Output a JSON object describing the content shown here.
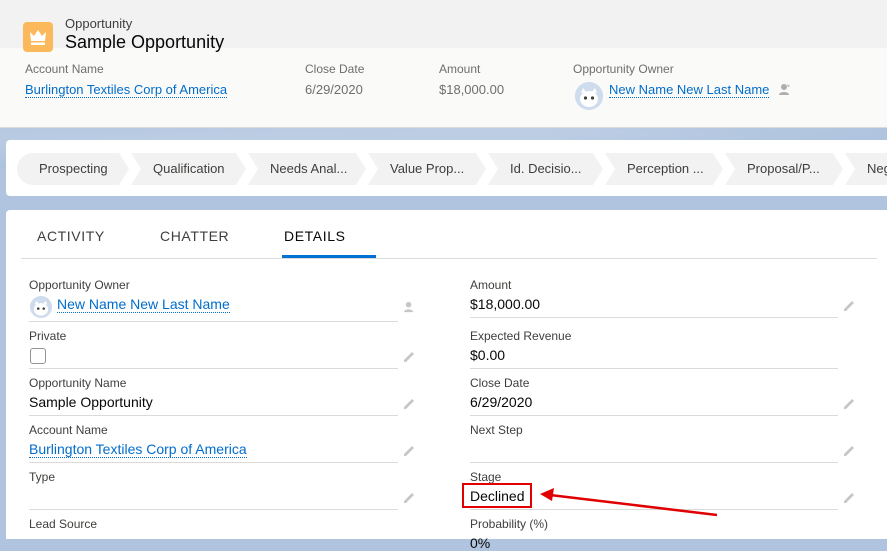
{
  "header": {
    "object_type": "Opportunity",
    "record_title": "Sample Opportunity",
    "icon": "crown-icon",
    "icon_color": "#fcb95b",
    "fields": [
      {
        "label": "Account Name",
        "value": "Burlington Textiles Corp of America"
      },
      {
        "label": "Close Date",
        "value": "6/29/2020"
      },
      {
        "label": "Amount",
        "value": "$18,000.00"
      },
      {
        "label": "Opportunity Owner",
        "value": "New Name New Last Name"
      }
    ]
  },
  "path": {
    "steps": [
      "Prospecting",
      "Qualification",
      "Needs Anal...",
      "Value Prop...",
      "Id. Decisio...",
      "Perception ...",
      "Proposal/P...",
      "Nego"
    ]
  },
  "tabs": [
    {
      "label": "ACTIVITY"
    },
    {
      "label": "CHATTER"
    },
    {
      "label": "DETAILS"
    }
  ],
  "details": {
    "left": [
      {
        "label": "Opportunity Owner",
        "value": "New Name New Last Name"
      },
      {
        "label": "Private",
        "value": ""
      },
      {
        "label": "Opportunity Name",
        "value": "Sample Opportunity"
      },
      {
        "label": "Account Name",
        "value": "Burlington Textiles Corp of America"
      },
      {
        "label": "Type",
        "value": ""
      },
      {
        "label": "Lead Source",
        "value": ""
      }
    ],
    "right": [
      {
        "label": "Amount",
        "value": "$18,000.00"
      },
      {
        "label": "Expected Revenue",
        "value": "$0.00"
      },
      {
        "label": "Close Date",
        "value": "6/29/2020"
      },
      {
        "label": "Next Step",
        "value": ""
      },
      {
        "label": "Stage",
        "value": "Declined"
      },
      {
        "label": "Probability (%)",
        "value": "0%"
      }
    ]
  },
  "annotation": {
    "highlight_color": "#e00000"
  }
}
